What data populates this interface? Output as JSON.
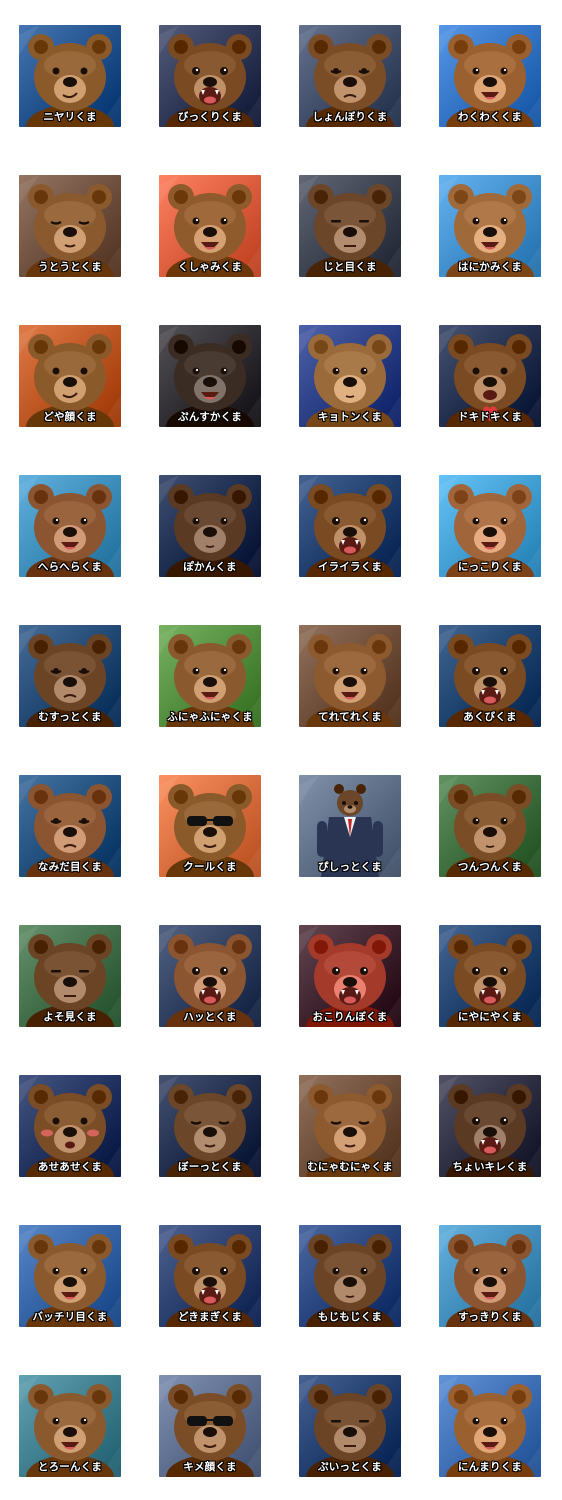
{
  "stickers": [
    {
      "label": "ニヤリくま",
      "bg": "#1d4e8a",
      "fur": "#8b5a2b",
      "expr": "smirk"
    },
    {
      "label": "びっくりくま",
      "bg": "#2b3352",
      "fur": "#7a4a22",
      "expr": "shock"
    },
    {
      "label": "しょんぼりくま",
      "bg": "#3c4a66",
      "fur": "#7b4d26",
      "expr": "sad"
    },
    {
      "label": "わくわくくま",
      "bg": "#2f6fc0",
      "fur": "#9a6030",
      "expr": "happy"
    },
    {
      "label": "うとうとくま",
      "bg": "#6c4c3a",
      "fur": "#8a5a2e",
      "expr": "sleepy"
    },
    {
      "label": "くしゃみくま",
      "bg": "#d85a3a",
      "fur": "#8f5a2c",
      "expr": "sneeze"
    },
    {
      "label": "じと目くま",
      "bg": "#3a3f4d",
      "fur": "#6b4628",
      "expr": "squint"
    },
    {
      "label": "はにかみくま",
      "bg": "#3d8bc9",
      "fur": "#a0693a",
      "expr": "smile"
    },
    {
      "label": "どや顔くま",
      "bg": "#b9521f",
      "fur": "#8a5a2b",
      "expr": "smug"
    },
    {
      "label": "ぷんすかくま",
      "bg": "#2c2a2e",
      "fur": "#3a2c22",
      "expr": "angry"
    },
    {
      "label": "キョトンくま",
      "bg": "#263a82",
      "fur": "#9a6a3a",
      "expr": "blank"
    },
    {
      "label": "ドキドキくま",
      "bg": "#1e2b4a",
      "fur": "#7a4a22",
      "expr": "heart"
    },
    {
      "label": "へらへらくま",
      "bg": "#3a8ab8",
      "fur": "#8a5530",
      "expr": "grin"
    },
    {
      "label": "ぽかんくま",
      "bg": "#18284a",
      "fur": "#5a3a22",
      "expr": "blank"
    },
    {
      "label": "イライラくま",
      "bg": "#1d3b6a",
      "fur": "#7a4a22",
      "expr": "roar"
    },
    {
      "label": "にっこりくま",
      "bg": "#3d9bcf",
      "fur": "#a0653a",
      "expr": "happy"
    },
    {
      "label": "むすっとくま",
      "bg": "#1e4470",
      "fur": "#6b4426",
      "expr": "sad"
    },
    {
      "label": "ふにゃふにゃくま",
      "bg": "#4f8a3a",
      "fur": "#8a5a2e",
      "expr": "smile"
    },
    {
      "label": "てれてれくま",
      "bg": "#6a4a34",
      "fur": "#8d5a30",
      "expr": "grin"
    },
    {
      "label": "あくびくま",
      "bg": "#1a3e6a",
      "fur": "#7a4a22",
      "expr": "roar"
    },
    {
      "label": "なみだ目くま",
      "bg": "#1d4b7a",
      "fur": "#8a5530",
      "expr": "sad"
    },
    {
      "label": "クールくま",
      "bg": "#d46a3a",
      "fur": "#8a5a2b",
      "expr": "cool"
    },
    {
      "label": "ぴしっとくま",
      "bg": "#5a6a82",
      "fur": "#6b4628",
      "expr": "suit"
    },
    {
      "label": "つんつんくま",
      "bg": "#3a6a3a",
      "fur": "#7b4d26",
      "expr": "blank"
    },
    {
      "label": "よそ見くま",
      "bg": "#3d6a44",
      "fur": "#6b4426",
      "expr": "squint"
    },
    {
      "label": "ハッとくま",
      "bg": "#2a3a5a",
      "fur": "#8a5530",
      "expr": "roar"
    },
    {
      "label": "おこりんぼくま",
      "bg": "#3a1e2a",
      "fur": "#a33a2a",
      "expr": "roar"
    },
    {
      "label": "にやにやくま",
      "bg": "#1d3e6a",
      "fur": "#7a4a22",
      "expr": "roar"
    },
    {
      "label": "あせあせくま",
      "bg": "#1e2e5a",
      "fur": "#7b4d26",
      "expr": "blush"
    },
    {
      "label": "ぼーっとくま",
      "bg": "#1d2a4a",
      "fur": "#6b4628",
      "expr": "sleepy"
    },
    {
      "label": "むにゃむにゃくま",
      "bg": "#6a4a34",
      "fur": "#8d5a30",
      "expr": "sleepy"
    },
    {
      "label": "ちょいキレくま",
      "bg": "#2a2a3e",
      "fur": "#5a3a22",
      "expr": "roar"
    },
    {
      "label": "バッチリ目くま",
      "bg": "#2f5fa0",
      "fur": "#8a5a2e",
      "expr": "grin"
    },
    {
      "label": "どきまぎくま",
      "bg": "#263a6a",
      "fur": "#7a4a22",
      "expr": "shock"
    },
    {
      "label": "もじもじくま",
      "bg": "#23407a",
      "fur": "#6b4426",
      "expr": "blank"
    },
    {
      "label": "すっきりくま",
      "bg": "#3d8ab8",
      "fur": "#8a5530",
      "expr": "happy"
    },
    {
      "label": "とろーんくま",
      "bg": "#3a7a8a",
      "fur": "#8a5a2e",
      "expr": "smile"
    },
    {
      "label": "キメ顔くま",
      "bg": "#5a6a8a",
      "fur": "#7b4d26",
      "expr": "cool"
    },
    {
      "label": "ぷいっとくま",
      "bg": "#1e3a6a",
      "fur": "#6b4426",
      "expr": "squint"
    },
    {
      "label": "にんまりくま",
      "bg": "#3a6ab0",
      "fur": "#9a6030",
      "expr": "grin"
    }
  ]
}
